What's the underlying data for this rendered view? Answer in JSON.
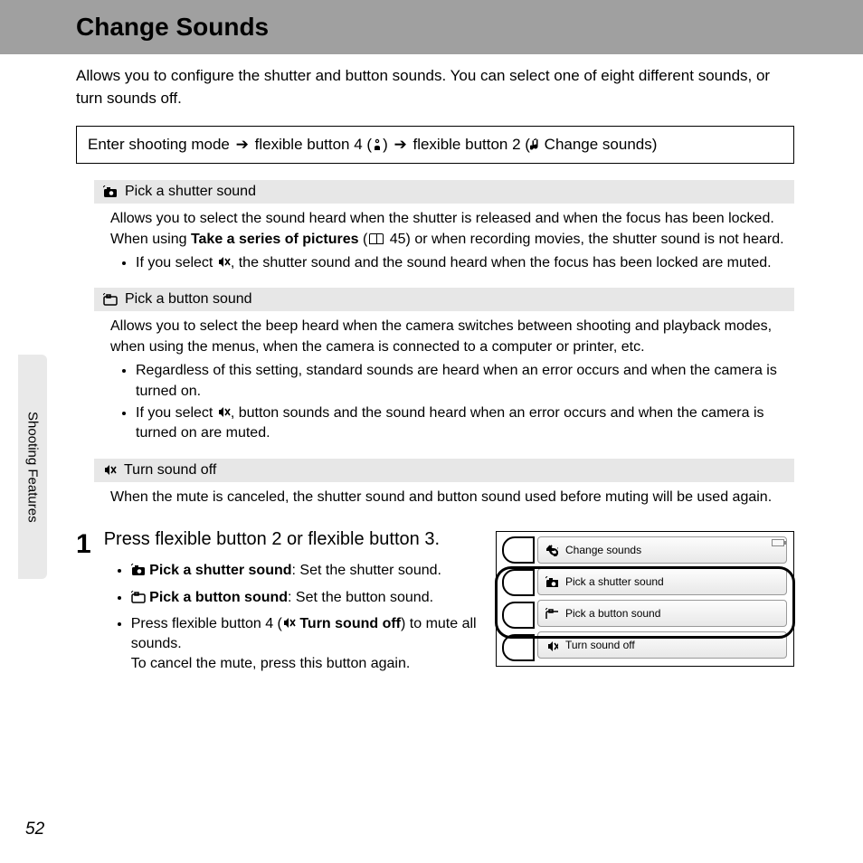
{
  "title": "Change Sounds",
  "intro": "Allows you to configure the shutter and button sounds. You can select one of eight different sounds, or turn sounds off.",
  "path": {
    "p1": "Enter shooting mode",
    "p2": "flexible button 4 (",
    "p3": ")",
    "p4": "flexible button 2 (",
    "p5": " Change sounds)"
  },
  "sections": {
    "shutter": {
      "header": "Pick a shutter sound",
      "body1": "Allows you to select the sound heard when the shutter is released and when the focus has been locked.",
      "body2a": "When using ",
      "body2b": "Take a series of pictures",
      "body2c": " (",
      "body2d": " 45) or when recording movies, the shutter sound is not heard.",
      "li1a": "If you select ",
      "li1b": ", the shutter sound and the sound heard when the focus has been locked are muted."
    },
    "button": {
      "header": "Pick a button sound",
      "body": "Allows you to select the beep heard when the camera switches between shooting and playback modes, when using the menus, when the camera is connected to a computer or printer, etc.",
      "li1": "Regardless of this setting, standard sounds are heard when an error occurs and when the camera is turned on.",
      "li2a": "If you select ",
      "li2b": ", button sounds and the sound heard when an error occurs and when the camera is turned on are muted."
    },
    "off": {
      "header": "Turn sound off",
      "body": "When the mute is canceled, the shutter sound and button sound used before muting will be used again."
    }
  },
  "step": {
    "num": "1",
    "title": "Press flexible button 2 or flexible button 3.",
    "li1a": "Pick a shutter sound",
    "li1b": ": Set the shutter sound.",
    "li2a": "Pick a button sound",
    "li2b": ": Set the button sound.",
    "li3a": "Press flexible button 4 (",
    "li3b": " Turn sound off",
    "li3c": ") to mute all sounds.",
    "li3d": "To cancel the mute, press this button again."
  },
  "menu": {
    "m1": "Change sounds",
    "m2": "Pick a shutter sound",
    "m3": "Pick a button sound",
    "m4": "Turn sound off"
  },
  "side_tab": "Shooting Features",
  "page_number": "52"
}
